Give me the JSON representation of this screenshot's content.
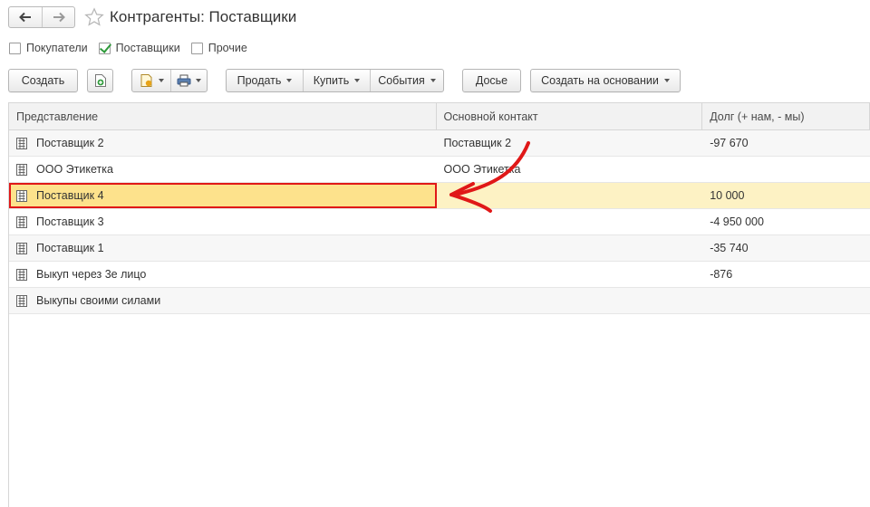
{
  "window": {
    "title": "Контрагенты: Поставщики",
    "back_icon": "arrow-left-icon",
    "forward_icon": "arrow-right-icon",
    "favorite_icon": "star-icon"
  },
  "filters": [
    {
      "label": "Покупатели",
      "checked": false
    },
    {
      "label": "Поставщики",
      "checked": true
    },
    {
      "label": "Прочие",
      "checked": false
    }
  ],
  "toolbar": {
    "create_label": "Создать",
    "sell_label": "Продать",
    "buy_label": "Купить",
    "events_label": "События",
    "dossier_label": "Досье",
    "create_based_label": "Создать на основании"
  },
  "table": {
    "columns": [
      "Представление",
      "Основной контакт",
      "Долг (+ нам, - мы)"
    ],
    "rows": [
      {
        "name": "Поставщик 2",
        "contact": "Поставщик 2",
        "debt": "-97 670"
      },
      {
        "name": "ООО Этикетка",
        "contact": "ООО Этикетка",
        "debt": ""
      },
      {
        "name": "Поставщик 4",
        "contact": "",
        "debt": "10 000"
      },
      {
        "name": "Поставщик 3",
        "contact": "",
        "debt": "-4 950 000"
      },
      {
        "name": "Поставщик 1",
        "contact": "",
        "debt": "-35 740"
      },
      {
        "name": "Выкуп через 3е лицо",
        "contact": "",
        "debt": "-876"
      },
      {
        "name": "Выкупы своими силами",
        "contact": "",
        "debt": ""
      }
    ]
  },
  "colors": {
    "selection_fill": "#fde28c",
    "selection_row": "#fdf2c4",
    "highlight_border": "#e01818",
    "check_green": "#2e9a3a"
  }
}
